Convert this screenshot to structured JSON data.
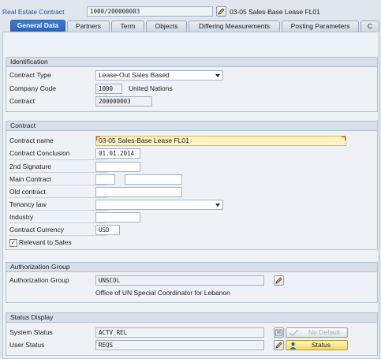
{
  "header": {
    "contract_label": "Real Estate Contract",
    "contract_value": "1000/200000003",
    "contract_description": "03-05 Sales-Base Lease FL01"
  },
  "tabs": [
    {
      "label": "General Data",
      "active": true
    },
    {
      "label": "Partners"
    },
    {
      "label": "Term"
    },
    {
      "label": "Objects"
    },
    {
      "label": "Differing Measurements"
    },
    {
      "label": "Posting Parameters"
    },
    {
      "label": "C"
    }
  ],
  "identification": {
    "title": "Identification",
    "contract_type_label": "Contract Type",
    "contract_type_value": "Lease-Out Sales Based",
    "company_code_label": "Company Code",
    "company_code_value": "1000",
    "company_code_name": "United Nations",
    "contract_label": "Contract",
    "contract_value": "200000003"
  },
  "contract": {
    "title": "Contract",
    "name_label": "Contract name",
    "name_value": "03-05 Sales-Base Lease FL01",
    "conclusion_label": "Contract Conclusion",
    "conclusion_value": "01.01.2014",
    "second_signature_label": "2nd Signature",
    "second_signature_value": "",
    "main_contract_label": "Main Contract",
    "main_contract_value_1": "",
    "main_contract_value_2": "",
    "old_contract_label": "Old contract",
    "old_contract_value": "",
    "tenancy_law_label": "Tenancy law",
    "tenancy_law_value": "",
    "industry_label": "Industry",
    "industry_value": "",
    "currency_label": "Contract Currency",
    "currency_value": "USD",
    "relevant_sales_label": "Relevant to Sales",
    "relevant_sales_checked": "✓"
  },
  "authorization": {
    "title": "Authorization Group",
    "group_label": "Authorization Group",
    "group_value": "UNSCOL",
    "group_description": "Office of UN Special Coordinator for Lebanon"
  },
  "status": {
    "title": "Status Display",
    "system_status_label": "System Status",
    "system_status_value": "ACTV REL",
    "user_status_label": "User Status",
    "user_status_value": "REQS",
    "no_default_label": "No Default",
    "status_button_label": "Status"
  }
}
